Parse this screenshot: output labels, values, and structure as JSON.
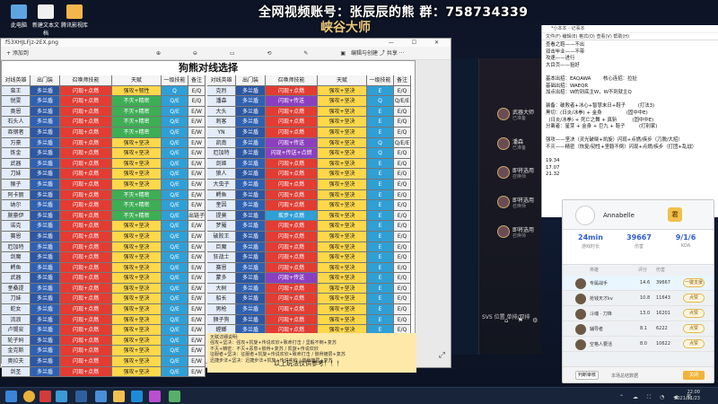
{
  "overlay": {
    "title": "全网视频账号：张辰辰的熊  群：758734339",
    "subtitle": "峡谷大师"
  },
  "desktop_icons": [
    {
      "label": "此电脑",
      "color": "#5fa4e2"
    },
    {
      "label": "新建文本文档",
      "color": "#f0f0f0"
    },
    {
      "label": "腾讯影视库",
      "color": "#f3b64b"
    }
  ],
  "viewer": {
    "title": "f53XHJLFjz-2EX.png",
    "add_label": "+ 添加到",
    "tools": "⊕ ⊖ ▭ ⟲ ✎ ▣",
    "right_tools": "编辑与创建  ⤴ 共享  ···",
    "controls": "— ☐ ✕",
    "sheet_title": "狗熊对线选择",
    "headers": [
      "对线英雄",
      "出门装",
      "召唤师技能",
      "天赋",
      "一级技能",
      "备注"
    ],
    "left_rows": [
      [
        "蛮王",
        "多兰盾",
        "闪现+点燃",
        "强攻+韧性",
        "Q",
        "E/Q"
      ],
      [
        "锐雯",
        "多兰盾",
        "闪现+点燃",
        "不灭+精密",
        "Q/E",
        "E/Q"
      ],
      [
        "奥恩",
        "多兰盾",
        "闪现+点燃",
        "不灭+精密",
        "Q/E",
        "E/W"
      ],
      [
        "石头人",
        "多兰盾",
        "闪现+点燃",
        "不灭+精密",
        "Q/E",
        "E/W"
      ],
      [
        "吞钢者",
        "多兰盾",
        "闪现+点燃",
        "不灭+精密",
        "Q/E",
        "E/W"
      ],
      [
        "万豪",
        "多兰盾",
        "闪现+点燃",
        "强攻+坚决",
        "Q/E",
        "E/W"
      ],
      [
        "炼金",
        "多兰盾",
        "闪现+点燃",
        "强攻+坚决",
        "Q/E",
        "E/W"
      ],
      [
        "武器",
        "多兰盾",
        "闪现+点燃",
        "强攻+坚决",
        "Q/E",
        "E/W"
      ],
      [
        "刀妹",
        "多兰盾",
        "闪现+点燃",
        "强攻+坚决",
        "Q/E",
        "E/W"
      ],
      [
        "猴子",
        "多兰盾",
        "闪现+点燃",
        "强攻+坚决",
        "Q/E",
        "E/W"
      ],
      [
        "阿卡丽",
        "多兰盾",
        "闪现+点燃",
        "不灭+精密",
        "Q/E",
        "E/W"
      ],
      [
        "纳尔",
        "多兰盾",
        "闪现+点燃",
        "不灭+精密",
        "Q/E",
        "E/W"
      ],
      [
        "腕豪伊",
        "多兰盾",
        "闪现+点燃",
        "不灭+精密",
        "Q/E",
        "出链子"
      ],
      [
        "诺克",
        "多兰盾",
        "闪现+点燃",
        "强攻+坚决",
        "Q/E",
        "E/W"
      ],
      [
        "赛恩",
        "多兰盾",
        "闪现+点燃",
        "强攻+坚决",
        "Q/E",
        "E/W"
      ],
      [
        "厄加特",
        "多兰盾",
        "闪现+点燃",
        "强攻+坚决",
        "Q/E",
        "E/W"
      ],
      [
        "剑魔",
        "多兰盾",
        "闪现+点燃",
        "强攻+坚决",
        "Q/E",
        "E/W"
      ],
      [
        "鳄鱼",
        "多兰盾",
        "闪现+点燃",
        "强攻+坚决",
        "Q/E",
        "E/W"
      ],
      [
        "武器",
        "多兰盾",
        "闪现+点燃",
        "强攻+坚决",
        "Q/E",
        "E/W"
      ],
      [
        "奎桑提",
        "多兰盾",
        "闪现+点燃",
        "强攻+坚决",
        "Q/E",
        "E/W"
      ],
      [
        "刀妹",
        "多兰盾",
        "闪现+点燃",
        "强攻+坚决",
        "Q/E",
        "E/W"
      ],
      [
        "蛇女",
        "多兰盾",
        "闪现+点燃",
        "强攻+坚决",
        "Q/E",
        "E/W"
      ],
      [
        "流浪",
        "多兰盾",
        "闪现+点燃",
        "强攻+坚决",
        "Q/E",
        "E/W"
      ],
      [
        "卢锡安",
        "多兰盾",
        "闪现+点燃",
        "强攻+坚决",
        "Q/E",
        "E/W"
      ],
      [
        "轮子妈",
        "多兰盾",
        "闪现+点燃",
        "强攻+坚决",
        "Q/E",
        "E/W"
      ],
      [
        "金克斯",
        "多兰盾",
        "闪现+点燃",
        "强攻+坚决",
        "Q/E",
        "E/W"
      ],
      [
        "奥拉夫",
        "多兰盾",
        "闪现+点燃",
        "强攻+坚决",
        "Q/E",
        "E/W"
      ],
      [
        "剑圣",
        "多兰盾",
        "闪现+点燃",
        "强攻+坚决",
        "Q/E",
        "E/W"
      ]
    ],
    "right_rows": [
      [
        "克烈",
        "多兰盾",
        "闪现+点燃",
        "强攻+坚决",
        "E",
        "E/Q"
      ],
      [
        "潘森",
        "多兰盾",
        "闪现+传送",
        "强攻+坚决",
        "Q",
        "Q/E/E"
      ],
      [
        "大头",
        "多兰盾",
        "闪现+点燃",
        "强攻+坚决",
        "E",
        "E/Q"
      ],
      [
        "刺客",
        "多兰盾",
        "闪现+点燃",
        "强攻+坚决",
        "E",
        "E/Q"
      ],
      [
        "YN",
        "多兰盾",
        "闪现+点燃",
        "强攻+坚决",
        "E",
        "E/Q"
      ],
      [
        "凯南",
        "多兰盾",
        "闪现+传送",
        "强攻+坚决",
        "Q",
        "Q/E/E"
      ],
      [
        "厄加特",
        "多兰盾",
        "闪现+传送+点燃",
        "强攻+坚决",
        "Q",
        "E/Q"
      ],
      [
        "剑姬",
        "多兰盾",
        "闪现+点燃",
        "强攻+坚决",
        "E",
        "E/Q"
      ],
      [
        "狼人",
        "多兰盾",
        "闪现+点燃",
        "强攻+坚决",
        "E",
        "E/Q"
      ],
      [
        "大虫子",
        "多兰盾",
        "闪现+点燃",
        "强攻+坚决",
        "E",
        "E/Q"
      ],
      [
        "鳄鱼",
        "多兰盾",
        "闪现+点燃",
        "强攻+坚决",
        "E",
        "E/Q"
      ],
      [
        "奎因",
        "多兰盾",
        "闪现+点燃",
        "强攻+坚决",
        "E",
        "E/Q"
      ],
      [
        "提莫",
        "多兰盾",
        "疾步+点燃",
        "强攻+坚决",
        "E",
        "E/Q"
      ],
      [
        "梦魇",
        "多兰盾",
        "闪现+点燃",
        "强攻+坚决",
        "E",
        "E/Q"
      ],
      [
        "破败王",
        "多兰盾",
        "闪现+点燃",
        "强攻+坚决",
        "E",
        "E/Q"
      ],
      [
        "巨魔",
        "多兰盾",
        "闪现+点燃",
        "强攻+坚决",
        "E",
        "E/Q"
      ],
      [
        "狂战士",
        "多兰盾",
        "闪现+点燃",
        "强攻+坚决",
        "E",
        "E/Q"
      ],
      [
        "赛恩",
        "多兰盾",
        "闪现+点燃",
        "强攻+坚决",
        "E",
        "E/Q"
      ],
      [
        "蒙多",
        "多兰盾",
        "闪现+传送",
        "强攻+坚决",
        "E",
        "E/Q"
      ],
      [
        "大树",
        "多兰盾",
        "闪现+点燃",
        "强攻+坚决",
        "E",
        "E/Q"
      ],
      [
        "船长",
        "多兰盾",
        "闪现+点燃",
        "强攻+坚决",
        "E",
        "E/Q"
      ],
      [
        "男枪",
        "多兰盾",
        "闪现+点燃",
        "强攻+坚决",
        "E",
        "E/Q"
      ],
      [
        "狮子狗",
        "多兰盾",
        "闪现+点燃",
        "强攻+坚决",
        "E",
        "E/Q"
      ],
      [
        "螳螂",
        "多兰盾",
        "闪现+点燃",
        "强攻+坚决",
        "E",
        "E/Q"
      ],
      [
        "蒙多",
        "多兰盾",
        "闪现+点燃",
        "强攻+坚决",
        "E",
        "E/Q"
      ]
    ],
    "notes": [
      "天赋详细说明:",
      "强攻+坚决：强攻+凯旋+传说欢欣+致命打击 / 坚毅不倒+复苏",
      "不灭+精密：不灭+恶意+骸骨+复苏 / 凯旋+传说欢欣",
      "征服者+坚决：征服者+凯旋+传说欢欣+致命打击 / 骸骨镀层+复苏",
      "迅捷步法+坚决：迅捷步法+凯旋+传说欢欣 / 骸骨镀层+复苏"
    ],
    "notes_tail": "以上玩法仅供参考！！！"
  },
  "lobby": {
    "slots": [
      {
        "name": "武器大师",
        "status": "已准备"
      },
      {
        "name": "潘森",
        "status": "已准备"
      },
      {
        "name": "即将选用",
        "status": "召唤师"
      },
      {
        "name": "即将选用",
        "status": "召唤师"
      },
      {
        "name": "即将选用",
        "status": "召唤师"
      }
    ],
    "bottom_text": "SVS 位置 单排/双排",
    "icons": "⌂ ⚑ ⚙"
  },
  "notepad": {
    "title": "*小本本 - 记事本",
    "menu": "文件(F)  编辑(E)  格式(O)  查看(V)  帮助(H)",
    "lines": [
      "查看之鞋——不出",
      "双击毕业——不带",
      "攻速——进行",
      "大目页——狙好",
      "",
      "基本出招：EAQAWA        核心连招：拉扯",
      "基础出招：WAEQR",
      "加点出招：W的到底主W，W不到就主Q",
      "",
      "装备：破败者+冰心+智慧末日+鞋子        (打法3)",
      "黑切：(日炎/冰拳) + 金身                (固中中E)",
      "  (日炎/冰拳) + 死亡之舞 + 真斩          (固中中E)",
      "分离者：星芽 + 金身 + 巨九 + 鞋子         (打别家)",
      "",
      "强攻——坚决（灵光破晓+凯旋）闪现+点燃/疾步（刀脱/大招）",
      "不灭——精密（恢复/韧性+坚毅不倒）闪现+点燃/疾步（打团+乱战）",
      "",
      "19.34",
      "17.07",
      "21.32"
    ]
  },
  "card": {
    "name": "Annabelle",
    "badge": "君",
    "stats": [
      {
        "value": "24min",
        "label": "游戏时长"
      },
      {
        "value": "39667",
        "label": "伤害"
      },
      {
        "value": "9/1/6",
        "label": "KDA"
      }
    ],
    "table_headers": [
      "英雄",
      "评分",
      "伤害"
    ],
    "rows": [
      {
        "name": "专属战手",
        "score": "14.6",
        "damage": "39667",
        "btn": "一键支援"
      },
      {
        "name": "抢钱天才kv",
        "score": "10.8",
        "damage": "11643",
        "btn": "点赞"
      },
      {
        "name": "斗魂 · 刀锋",
        "score": "13.0",
        "damage": "16201",
        "btn": "点赞"
      },
      {
        "name": "辅导者",
        "score": "8.1",
        "damage": "6222",
        "btn": "点赞"
      },
      {
        "name": "空格人要活",
        "score": "8.0",
        "damage": "10622",
        "btn": "点赞"
      }
    ],
    "foot_button": "判断审核",
    "foot_text": "本场总结数据",
    "close_button": "关闭"
  },
  "taskbar": {
    "time": "22:00",
    "date": "2021/11/23",
    "tray": "⌃ ☁ ⛶ ◔ ◀ 英"
  }
}
